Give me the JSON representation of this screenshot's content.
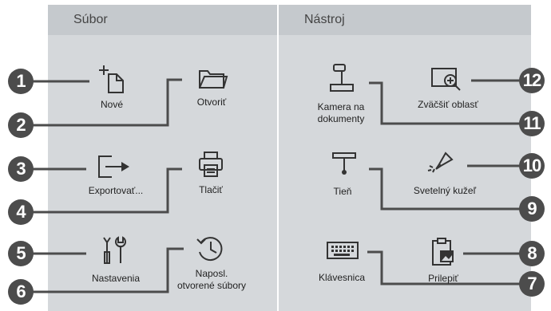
{
  "tabs": {
    "file": "Súbor",
    "tool": "Nástroj"
  },
  "file_items": {
    "new": "Nové",
    "open": "Otvoriť",
    "export": "Exportovať...",
    "print": "Tlačiť",
    "settings": "Nastavenia",
    "recent_line1": "Naposl.",
    "recent_line2": "otvorené súbory"
  },
  "tool_items": {
    "camera_line1": "Kamera na",
    "camera_line2": "dokumenty",
    "zoom": "Zväčšiť oblasť",
    "shade": "Tieň",
    "spotlight": "Svetelný kužeľ",
    "keyboard": "Klávesnica",
    "paste": "Prilepiť"
  },
  "callouts": [
    "1",
    "2",
    "3",
    "4",
    "5",
    "6",
    "7",
    "8",
    "9",
    "10",
    "11",
    "12"
  ],
  "colors": {
    "panel": "#d5d8db",
    "header": "#c5c9cd",
    "badge": "#4c4c4c",
    "icon": "#333333"
  }
}
